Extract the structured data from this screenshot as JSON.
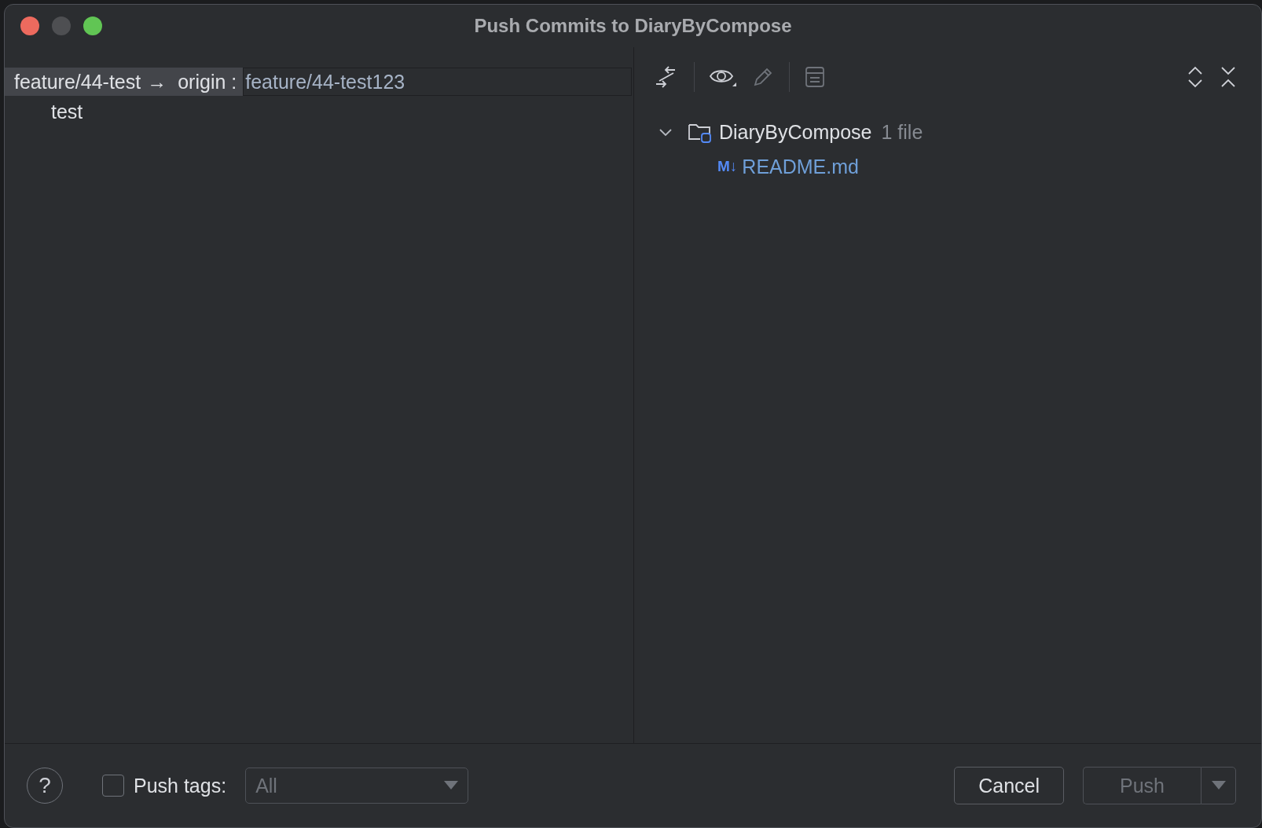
{
  "window": {
    "title": "Push Commits to DiaryByCompose"
  },
  "push_row": {
    "local_branch": "feature/44-test",
    "arrow": "→",
    "remote": "origin :",
    "target_branch": "feature/44-test123"
  },
  "commits": [
    {
      "message": "test"
    }
  ],
  "toolbar": [
    {
      "kind": "compare",
      "disabled": false
    },
    {
      "kind": "view",
      "disabled": false
    },
    {
      "kind": "edit",
      "disabled": true
    },
    {
      "kind": "document",
      "disabled": true
    }
  ],
  "changes": {
    "name": "DiaryByCompose",
    "count": "1 file",
    "expanded": true,
    "children": [
      {
        "badge": "M↓",
        "name": "README.md"
      }
    ]
  },
  "footer": {
    "help": "?",
    "push_tags": {
      "label": "Push tags:",
      "checked": false
    },
    "tags_dropdown": {
      "value": "All",
      "disabled": true
    },
    "buttons": [
      {
        "kind": "cancel",
        "label": "Cancel",
        "disabled": false
      },
      {
        "kind": "push",
        "label": "Push",
        "disabled": true
      }
    ]
  }
}
